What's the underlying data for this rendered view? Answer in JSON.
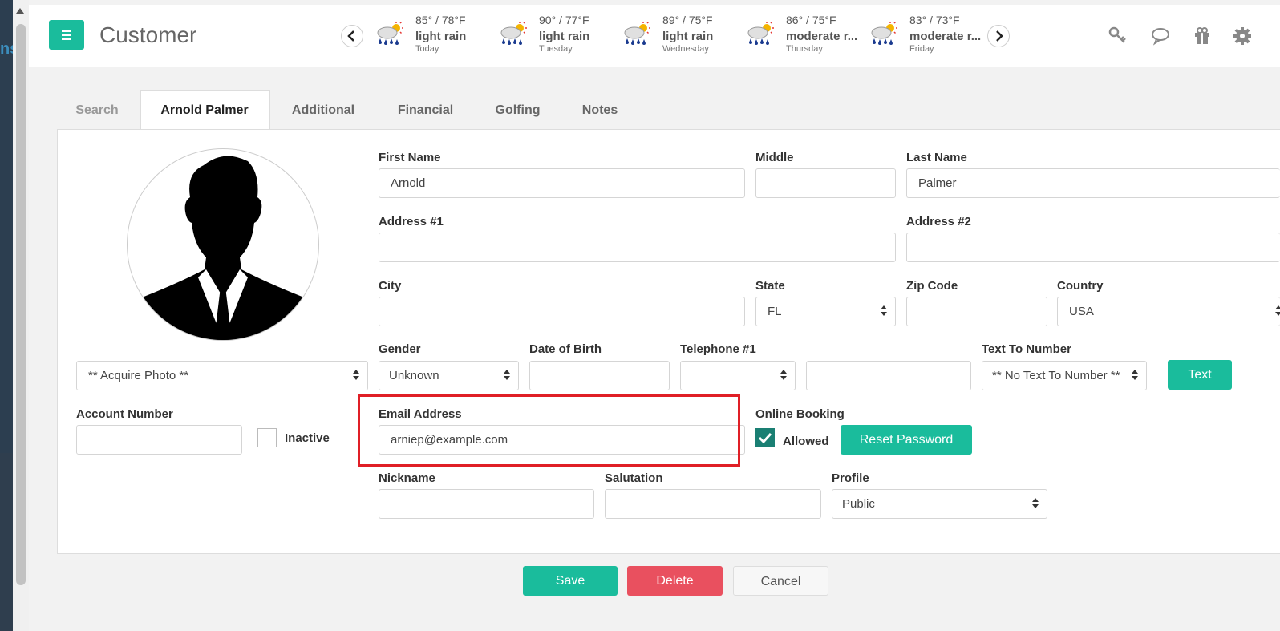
{
  "app": {
    "title": "Customer",
    "left_fragment": "ns"
  },
  "weather": [
    {
      "temp": "85° / 78°F",
      "condition": "light rain",
      "day": "Today"
    },
    {
      "temp": "90° / 77°F",
      "condition": "light rain",
      "day": "Tuesday"
    },
    {
      "temp": "89° / 75°F",
      "condition": "light rain",
      "day": "Wednesday"
    },
    {
      "temp": "86° / 75°F",
      "condition": "moderate r...",
      "day": "Thursday"
    },
    {
      "temp": "83° / 73°F",
      "condition": "moderate r...",
      "day": "Friday"
    }
  ],
  "tabs": [
    "Search",
    "Arnold Palmer",
    "Additional",
    "Financial",
    "Golfing",
    "Notes"
  ],
  "form": {
    "first_name": {
      "label": "First Name",
      "value": "Arnold"
    },
    "middle": {
      "label": "Middle",
      "value": ""
    },
    "last_name": {
      "label": "Last Name",
      "value": "Palmer"
    },
    "address1": {
      "label": "Address #1",
      "value": ""
    },
    "address2": {
      "label": "Address #2",
      "value": ""
    },
    "city": {
      "label": "City",
      "value": ""
    },
    "state": {
      "label": "State",
      "value": "FL"
    },
    "zip": {
      "label": "Zip Code",
      "value": ""
    },
    "country": {
      "label": "Country",
      "value": "USA"
    },
    "gender": {
      "label": "Gender",
      "value": "Unknown"
    },
    "dob": {
      "label": "Date of Birth",
      "value": ""
    },
    "telephone": {
      "label": "Telephone #1",
      "type_value": "",
      "value": ""
    },
    "text_to": {
      "label": "Text To Number",
      "value": "** No Text To Number **"
    },
    "text_button": "Text",
    "photo_select": "** Acquire Photo **",
    "account_number": {
      "label": "Account Number",
      "value": ""
    },
    "inactive_label": "Inactive",
    "email": {
      "label": "Email Address",
      "value": "arniep@example.com"
    },
    "online_booking": {
      "label": "Online Booking",
      "allowed_label": "Allowed",
      "allowed": true
    },
    "reset_password": "Reset Password",
    "nickname": {
      "label": "Nickname",
      "value": ""
    },
    "salutation": {
      "label": "Salutation",
      "value": ""
    },
    "profile": {
      "label": "Profile",
      "value": "Public"
    }
  },
  "actions": {
    "save": "Save",
    "delete": "Delete",
    "cancel": "Cancel"
  },
  "colors": {
    "accent": "#1abc9c",
    "danger": "#e9505f",
    "highlight": "#e01f26"
  }
}
